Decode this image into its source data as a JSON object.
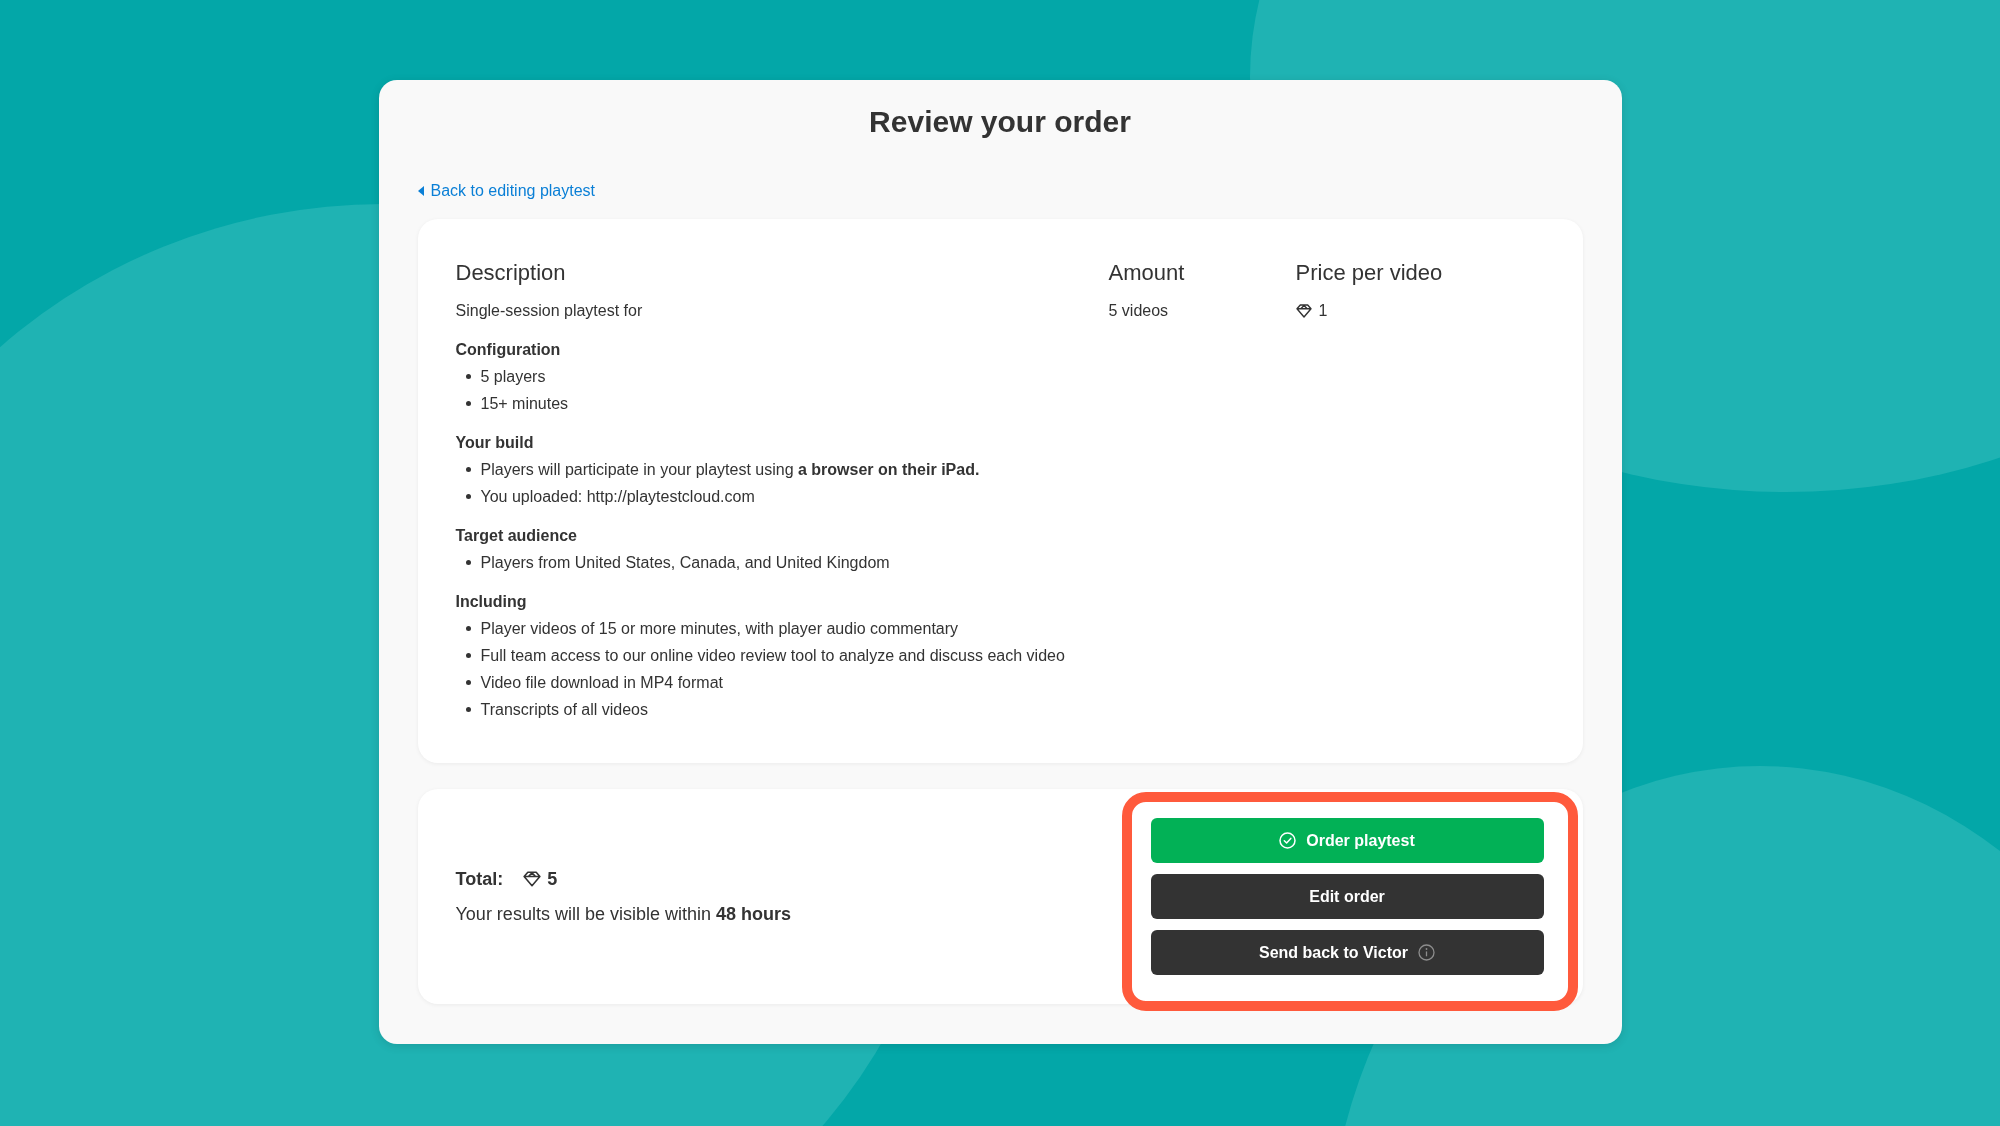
{
  "title": "Review your order",
  "back_link": {
    "label": "Back to editing playtest"
  },
  "summary": {
    "columns": [
      "Description",
      "Amount",
      "Price per video"
    ],
    "row": {
      "description": "Single-session playtest for",
      "amount": "5 videos",
      "price": "1"
    },
    "sections": [
      {
        "heading": "Configuration",
        "items": [
          "5 players",
          "15+ minutes"
        ]
      },
      {
        "heading": "Your build",
        "items": [
          "Players will participate in your playtest using **a browser on their iPad.**",
          "You uploaded: http://playtestcloud.com"
        ]
      },
      {
        "heading": "Target audience",
        "items": [
          "Players from United States, Canada, and United Kingdom"
        ]
      },
      {
        "heading": "Including",
        "items": [
          "Player videos of 15 or more minutes, with player audio commentary",
          "Full team access to our online video review tool to analyze and discuss each video",
          "Video file download in MP4 format",
          "Transcripts of all videos"
        ]
      }
    ]
  },
  "total": {
    "label": "Total:",
    "value": "5",
    "note": "Your results will be visible within **48 hours**"
  },
  "actions": {
    "highlighted": true,
    "buttons": [
      {
        "label": "Order playtest",
        "kind": "confirm"
      },
      {
        "label": "Edit order",
        "kind": "plain"
      },
      {
        "label": "Send back to Victor",
        "kind": "info"
      }
    ]
  }
}
